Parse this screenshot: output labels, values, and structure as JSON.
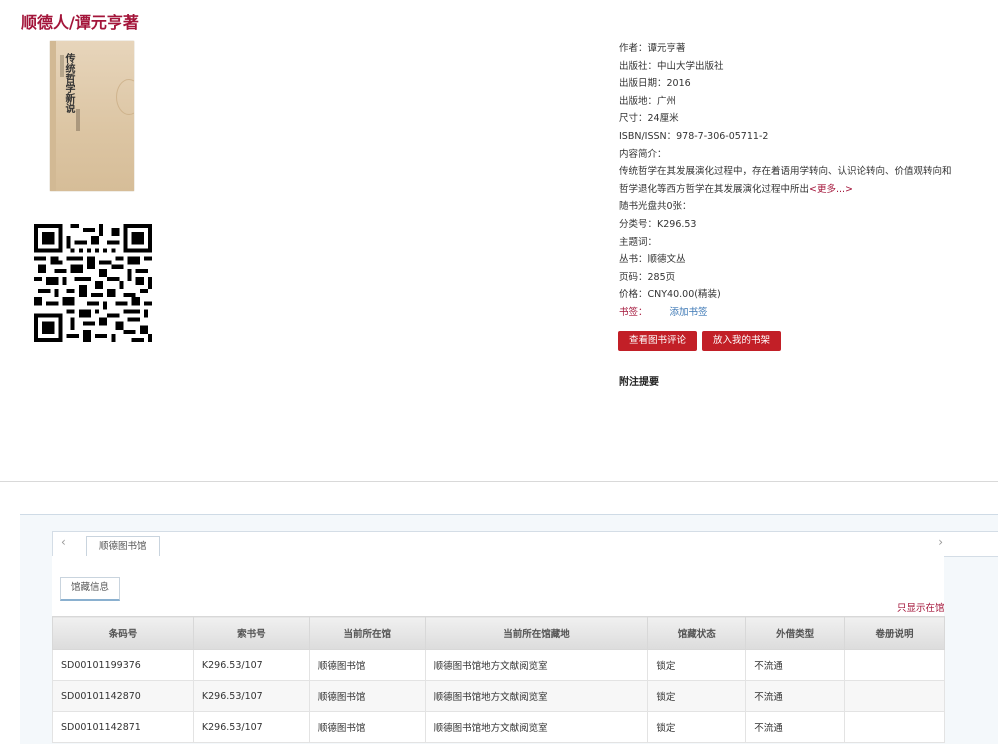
{
  "book": {
    "title": "顺德人/谭元亨著",
    "cover_title": "传统哲学新说"
  },
  "details": {
    "author": "作者：谭元亨著",
    "publisher": "出版社：中山大学出版社",
    "pub_date": "出版日期：2016",
    "pub_place": "出版地：广州",
    "size": "尺寸：24厘米",
    "isbn": "ISBN/ISSN：978-7-306-05711-2",
    "summary_label": "内容简介：",
    "summary_line1": "传统哲学在其发展演化过程中，存在着语用学转向、认识论转向、价值观转向和",
    "summary_line2": "哲学退化等西方哲学在其发展演化过程中所出",
    "more": "<更多...>",
    "cd": "随书光盘共0张：",
    "class_no": "分类号：K296.53",
    "subject": "主题词：",
    "series": "丛书：顺德文丛",
    "pages": "页码：285页",
    "price": "价格：CNY40.00(精装)",
    "bookmark_label": "书签：",
    "bookmark_link": "添加书签"
  },
  "buttons": {
    "review": "查看图书评论",
    "shelf": "放入我的书架"
  },
  "notes_heading": "附注提要",
  "tabs": {
    "library": "顺德图书馆",
    "holdings": "馆藏信息",
    "only_show": "只显示在馆"
  },
  "holdings": {
    "headers": [
      "条码号",
      "索书号",
      "当前所在馆",
      "当前所在馆藏地",
      "馆藏状态",
      "外借类型",
      "卷册说明"
    ],
    "rows": [
      [
        "SD00101199376",
        "K296.53/107",
        "顺德图书馆",
        "顺德图书馆地方文献阅览室",
        "锁定",
        "不流通",
        ""
      ],
      [
        "SD00101142870",
        "K296.53/107",
        "顺德图书馆",
        "顺德图书馆地方文献阅览室",
        "锁定",
        "不流通",
        ""
      ],
      [
        "SD00101142871",
        "K296.53/107",
        "顺德图书馆",
        "顺德图书馆地方文献阅览室",
        "锁定",
        "不流通",
        ""
      ]
    ]
  }
}
